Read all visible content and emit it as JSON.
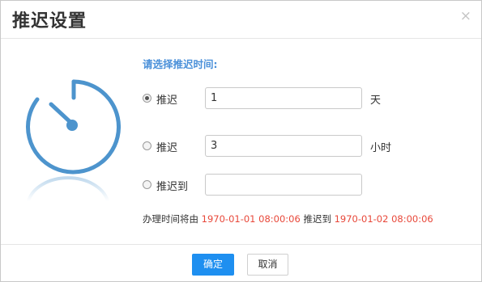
{
  "dialog": {
    "title": "推迟设置",
    "close_glyph": "×"
  },
  "prompt": "请选择推迟时间:",
  "options": [
    {
      "label": "推迟",
      "value": "1",
      "unit": "天",
      "selected": true
    },
    {
      "label": "推迟",
      "value": "3",
      "unit": "小时",
      "selected": false
    },
    {
      "label": "推迟到",
      "value": "",
      "unit": "",
      "selected": false
    }
  ],
  "summary": {
    "prefix": "办理时间将由 ",
    "from": "1970-01-01 08:00:06",
    "middle": " 推迟到 ",
    "to": "1970-01-02 08:00:06"
  },
  "buttons": {
    "ok": "确定",
    "cancel": "取消"
  },
  "colors": {
    "accent_blue": "#1e8ff0",
    "prompt_blue": "#4a90d9",
    "clock_blue": "#4d94cd",
    "date_red": "#e8483a"
  },
  "icons": {
    "clock": "stopwatch-icon",
    "close": "close-icon"
  }
}
